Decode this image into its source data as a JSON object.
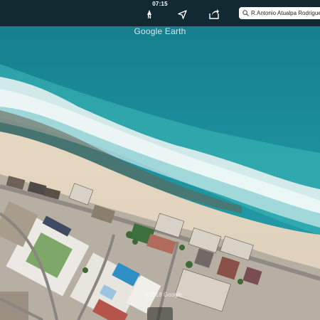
{
  "status_bar": {
    "time": "07:15"
  },
  "toolbar": {
    "compass_label": "N",
    "compass_icon": "compass-north-icon",
    "locate_icon": "location-arrow-icon",
    "share_icon": "share-icon",
    "search": {
      "icon": "search-icon",
      "value": "R.Antonio Atualpa Rodrigues"
    }
  },
  "map": {
    "watermark": "Google Earth",
    "attribution": "©2018 Google",
    "scene": "aerial view of beach shoreline with ocean waves, sand and beachfront buildings"
  },
  "colors": {
    "toolbar_bg": "#121e26",
    "ocean_deep": "#17808e",
    "ocean_light": "#2fa3ae",
    "sand": "#e8dcc8"
  }
}
